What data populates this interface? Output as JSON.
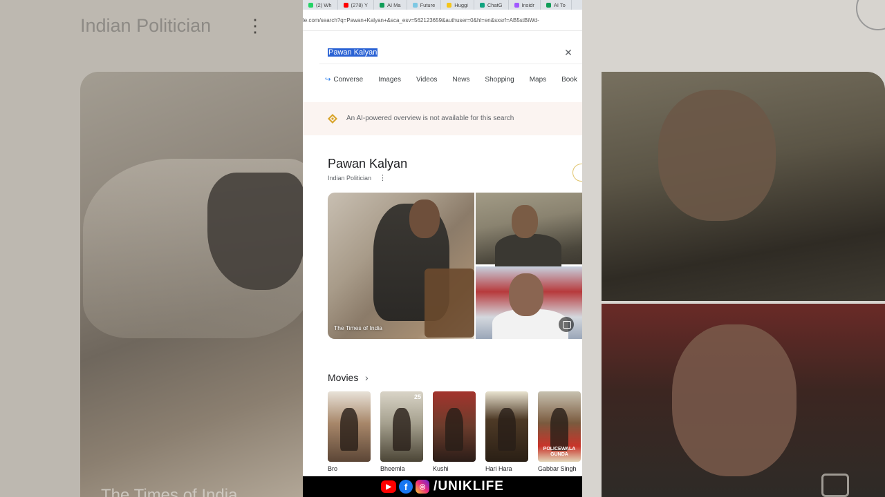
{
  "background": {
    "left_title": "Indian Politician",
    "left_caption": "The Times of India"
  },
  "browser": {
    "tabs": [
      {
        "label": "(2) Wh",
        "color": "#25d366"
      },
      {
        "label": "(278) Y",
        "color": "#ff0000"
      },
      {
        "label": "AI Ma",
        "color": "#0f9d58"
      },
      {
        "label": "Future",
        "color": "#7ec8e3"
      },
      {
        "label": "Huggi",
        "color": "#f5c518"
      },
      {
        "label": "ChatG",
        "color": "#10a37f"
      },
      {
        "label": "Insidr",
        "color": "#a259ff"
      },
      {
        "label": "AI To",
        "color": "#0f9d58"
      }
    ],
    "url": "le.com/search?q=Pawan+Kalyan+&sca_esv=562123659&authuser=0&hl=en&sxsrf=AB5stBiWd-"
  },
  "search": {
    "query": "Pawan Kalyan",
    "clear_icon": "close-icon"
  },
  "chips": [
    "Converse",
    "Images",
    "Videos",
    "News",
    "Shopping",
    "Maps",
    "Book"
  ],
  "ai_banner": {
    "text": "An AI-powered overview is not available for this search",
    "icon": "gemini-sparkle-icon",
    "accent": "#d8a42a"
  },
  "entity": {
    "name": "Pawan Kalyan",
    "subtitle": "Indian Politician",
    "image_caption": "The Times of India"
  },
  "movies": {
    "title": "Movies",
    "items": [
      {
        "title": "Bro",
        "badge": ""
      },
      {
        "title": "Bheemla",
        "badge": "25"
      },
      {
        "title": "Kushi",
        "badge": ""
      },
      {
        "title": "Hari Hara",
        "badge": ""
      },
      {
        "title": "Gabbar Singh",
        "badge": ""
      }
    ],
    "poster_stamp": "POLICEWALA GUNDA"
  },
  "social": {
    "handle": "/UNIKLIFE",
    "icons": [
      "youtube-icon",
      "facebook-icon",
      "instagram-icon"
    ]
  }
}
